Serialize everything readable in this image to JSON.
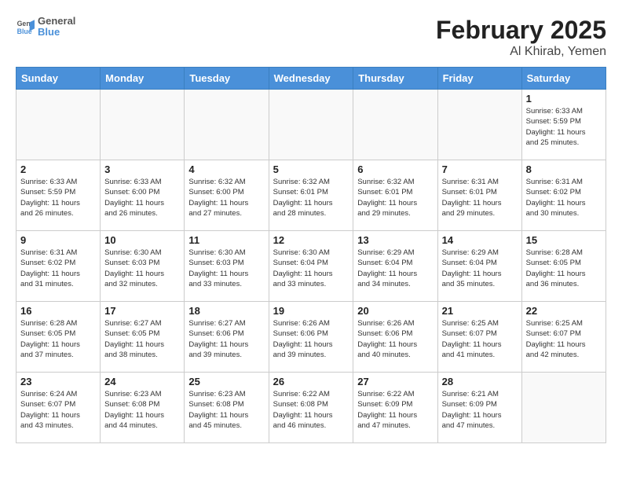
{
  "header": {
    "logo": {
      "line1": "General",
      "line2": "Blue"
    },
    "title": "February 2025",
    "subtitle": "Al Khirab, Yemen"
  },
  "days_of_week": [
    "Sunday",
    "Monday",
    "Tuesday",
    "Wednesday",
    "Thursday",
    "Friday",
    "Saturday"
  ],
  "weeks": [
    [
      {
        "day": "",
        "info": ""
      },
      {
        "day": "",
        "info": ""
      },
      {
        "day": "",
        "info": ""
      },
      {
        "day": "",
        "info": ""
      },
      {
        "day": "",
        "info": ""
      },
      {
        "day": "",
        "info": ""
      },
      {
        "day": "1",
        "info": "Sunrise: 6:33 AM\nSunset: 5:59 PM\nDaylight: 11 hours\nand 25 minutes."
      }
    ],
    [
      {
        "day": "2",
        "info": "Sunrise: 6:33 AM\nSunset: 5:59 PM\nDaylight: 11 hours\nand 26 minutes."
      },
      {
        "day": "3",
        "info": "Sunrise: 6:33 AM\nSunset: 6:00 PM\nDaylight: 11 hours\nand 26 minutes."
      },
      {
        "day": "4",
        "info": "Sunrise: 6:32 AM\nSunset: 6:00 PM\nDaylight: 11 hours\nand 27 minutes."
      },
      {
        "day": "5",
        "info": "Sunrise: 6:32 AM\nSunset: 6:01 PM\nDaylight: 11 hours\nand 28 minutes."
      },
      {
        "day": "6",
        "info": "Sunrise: 6:32 AM\nSunset: 6:01 PM\nDaylight: 11 hours\nand 29 minutes."
      },
      {
        "day": "7",
        "info": "Sunrise: 6:31 AM\nSunset: 6:01 PM\nDaylight: 11 hours\nand 29 minutes."
      },
      {
        "day": "8",
        "info": "Sunrise: 6:31 AM\nSunset: 6:02 PM\nDaylight: 11 hours\nand 30 minutes."
      }
    ],
    [
      {
        "day": "9",
        "info": "Sunrise: 6:31 AM\nSunset: 6:02 PM\nDaylight: 11 hours\nand 31 minutes."
      },
      {
        "day": "10",
        "info": "Sunrise: 6:30 AM\nSunset: 6:03 PM\nDaylight: 11 hours\nand 32 minutes."
      },
      {
        "day": "11",
        "info": "Sunrise: 6:30 AM\nSunset: 6:03 PM\nDaylight: 11 hours\nand 33 minutes."
      },
      {
        "day": "12",
        "info": "Sunrise: 6:30 AM\nSunset: 6:04 PM\nDaylight: 11 hours\nand 33 minutes."
      },
      {
        "day": "13",
        "info": "Sunrise: 6:29 AM\nSunset: 6:04 PM\nDaylight: 11 hours\nand 34 minutes."
      },
      {
        "day": "14",
        "info": "Sunrise: 6:29 AM\nSunset: 6:04 PM\nDaylight: 11 hours\nand 35 minutes."
      },
      {
        "day": "15",
        "info": "Sunrise: 6:28 AM\nSunset: 6:05 PM\nDaylight: 11 hours\nand 36 minutes."
      }
    ],
    [
      {
        "day": "16",
        "info": "Sunrise: 6:28 AM\nSunset: 6:05 PM\nDaylight: 11 hours\nand 37 minutes."
      },
      {
        "day": "17",
        "info": "Sunrise: 6:27 AM\nSunset: 6:05 PM\nDaylight: 11 hours\nand 38 minutes."
      },
      {
        "day": "18",
        "info": "Sunrise: 6:27 AM\nSunset: 6:06 PM\nDaylight: 11 hours\nand 39 minutes."
      },
      {
        "day": "19",
        "info": "Sunrise: 6:26 AM\nSunset: 6:06 PM\nDaylight: 11 hours\nand 39 minutes."
      },
      {
        "day": "20",
        "info": "Sunrise: 6:26 AM\nSunset: 6:06 PM\nDaylight: 11 hours\nand 40 minutes."
      },
      {
        "day": "21",
        "info": "Sunrise: 6:25 AM\nSunset: 6:07 PM\nDaylight: 11 hours\nand 41 minutes."
      },
      {
        "day": "22",
        "info": "Sunrise: 6:25 AM\nSunset: 6:07 PM\nDaylight: 11 hours\nand 42 minutes."
      }
    ],
    [
      {
        "day": "23",
        "info": "Sunrise: 6:24 AM\nSunset: 6:07 PM\nDaylight: 11 hours\nand 43 minutes."
      },
      {
        "day": "24",
        "info": "Sunrise: 6:23 AM\nSunset: 6:08 PM\nDaylight: 11 hours\nand 44 minutes."
      },
      {
        "day": "25",
        "info": "Sunrise: 6:23 AM\nSunset: 6:08 PM\nDaylight: 11 hours\nand 45 minutes."
      },
      {
        "day": "26",
        "info": "Sunrise: 6:22 AM\nSunset: 6:08 PM\nDaylight: 11 hours\nand 46 minutes."
      },
      {
        "day": "27",
        "info": "Sunrise: 6:22 AM\nSunset: 6:09 PM\nDaylight: 11 hours\nand 47 minutes."
      },
      {
        "day": "28",
        "info": "Sunrise: 6:21 AM\nSunset: 6:09 PM\nDaylight: 11 hours\nand 47 minutes."
      },
      {
        "day": "",
        "info": ""
      }
    ]
  ]
}
